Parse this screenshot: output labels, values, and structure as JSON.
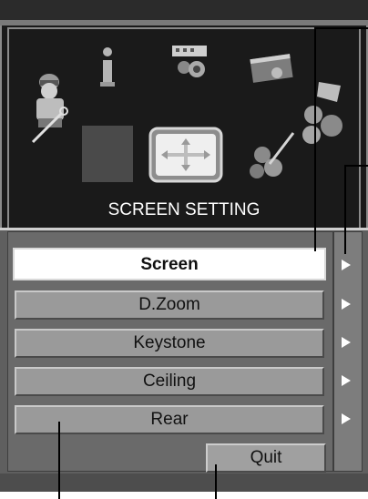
{
  "panel": {
    "title": "SCREEN SETTING",
    "icons": [
      "service-person-icon",
      "info-icon",
      "projector-icon",
      "screen-card-icon",
      "balls-icon",
      "blank-square-icon",
      "screen-setting-icon",
      "color-palette-icon"
    ]
  },
  "menu": {
    "items": [
      {
        "label": "Screen",
        "selected": true
      },
      {
        "label": "D.Zoom",
        "selected": false
      },
      {
        "label": "Keystone",
        "selected": false
      },
      {
        "label": "Ceiling",
        "selected": false
      },
      {
        "label": "Rear",
        "selected": false
      }
    ],
    "quit_label": "Quit"
  },
  "colors": {
    "panel_bg": "#1a1a1a",
    "menu_bg": "#5f5f5f",
    "button": "#9a9a9a",
    "selected_button": "#ffffff"
  }
}
